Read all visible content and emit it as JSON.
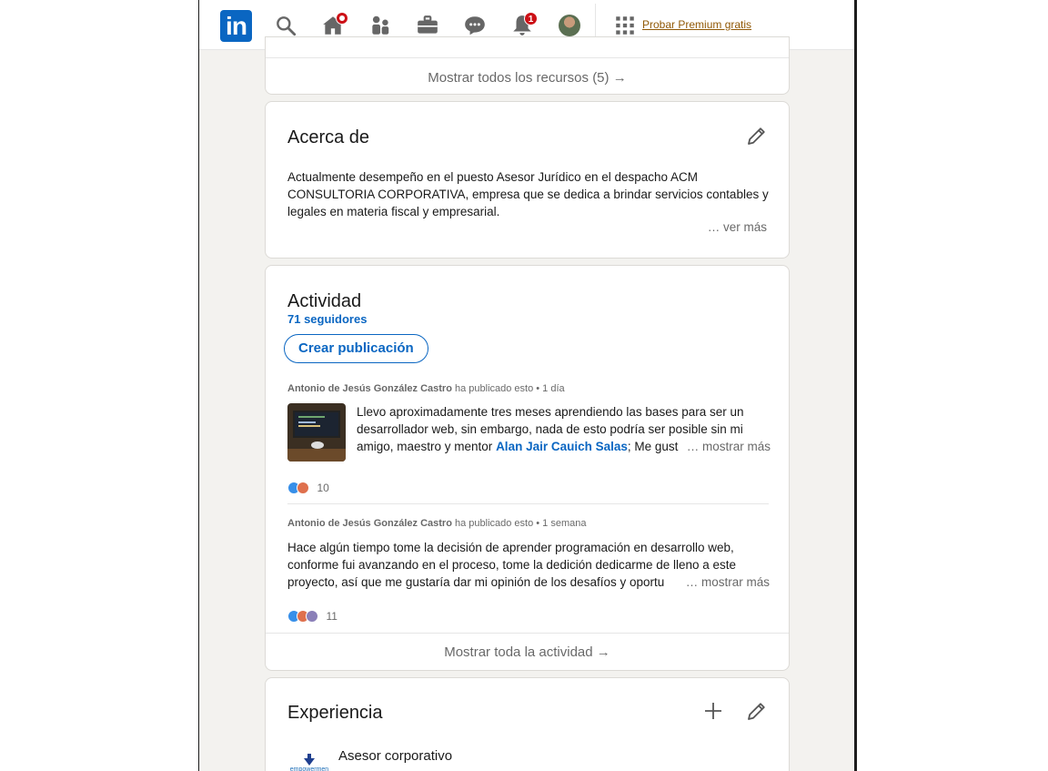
{
  "nav": {
    "logo": "in",
    "home_badge": "",
    "notifications_badge": "1",
    "premium_label": "Probar Premium gratis",
    "icons": [
      "search-icon",
      "home-icon",
      "my-network-icon",
      "jobs-icon",
      "messaging-icon",
      "notifications-icon",
      "apps-grid-icon"
    ]
  },
  "resources": {
    "show_all": "Mostrar todos los recursos (5) →"
  },
  "about": {
    "title": "Acerca de",
    "text": "Actualmente desempeño en el puesto Asesor Jurídico en el despacho ACM CONSULTORIA CORPORATIVA, empresa que se dedica a brindar servicios contables y legales en materia fiscal y empresarial.",
    "see_more": "… ver más"
  },
  "activity": {
    "title": "Actividad",
    "followers": "71 seguidores",
    "create_post": "Crear publicación",
    "posts": [
      {
        "author": "Antonio de Jesús González Castro",
        "action": "ha publicado esto • 1 día",
        "text_before": "Llevo aproximadamente tres meses aprendiendo las bases para ser un desarrollador web, sin embargo, nada de esto podría ser posible sin mi amigo, maestro y mentor ",
        "mention": "Alan Jair Cauich Salas",
        "text_after": "; Me gust",
        "see_more": "… mostrar más",
        "reactions": "10"
      },
      {
        "author": "Antonio de Jesús González Castro",
        "action": "ha publicado esto • 1 semana",
        "text": "Hace algún tiempo tome la decisión de aprender programación en desarrollo web, conforme fui avanzando en el proceso, tome la dedición dedicarme de lleno a este proyecto, así que me gustaría dar mi opinión de los desafíos y oportu",
        "see_more": "… mostrar más",
        "reactions": "11"
      }
    ],
    "show_all": "Mostrar toda la actividad →"
  },
  "experience": {
    "title": "Experiencia",
    "company_logo_text": "empowermen",
    "job_title": "Asesor corporativo"
  },
  "colors": {
    "brand_blue": "#0a66c2",
    "premium_gold": "#915907",
    "badge_red": "#cc1016",
    "background": "#f3f2ef"
  }
}
